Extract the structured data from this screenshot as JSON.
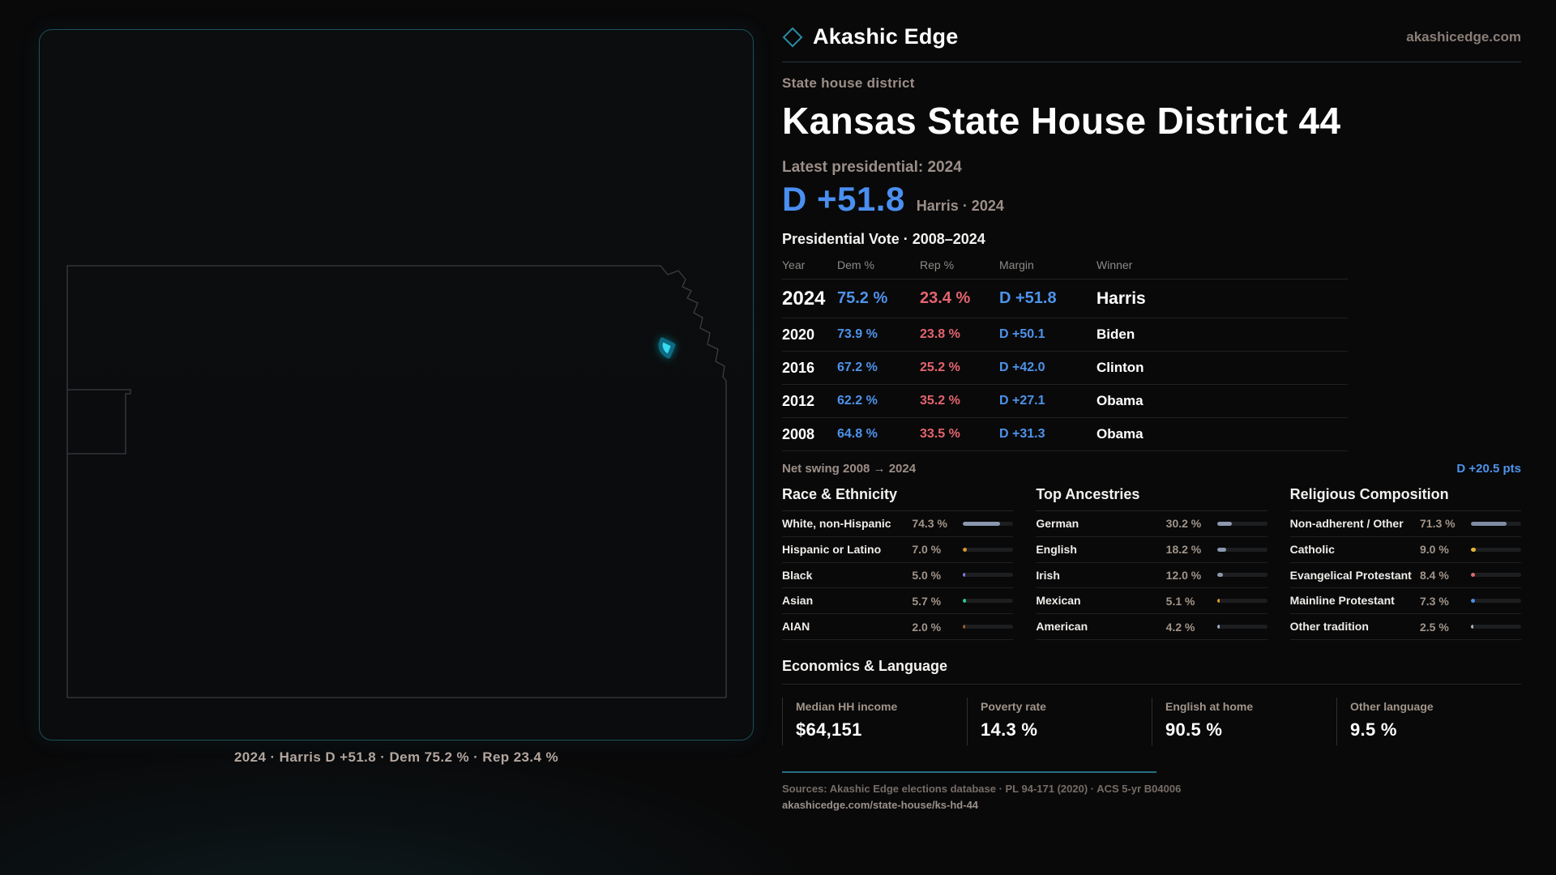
{
  "brand": {
    "name": "Akashic Edge",
    "website": "akashicedge.com"
  },
  "page": {
    "eyebrow": "State house district",
    "title": "Kansas State House District 44",
    "latest_label": "Latest presidential: 2024",
    "latest_margin": "D +51.8",
    "latest_sub": "Harris · 2024"
  },
  "vote_table": {
    "title": "Presidential Vote · 2008–2024",
    "columns": [
      "Year",
      "Dem %",
      "Rep %",
      "Margin",
      "Winner"
    ],
    "rows": [
      {
        "year": "2024",
        "dem": "75.2 %",
        "rep": "23.4 %",
        "margin": "D +51.8",
        "winner": "Harris",
        "featured": true
      },
      {
        "year": "2020",
        "dem": "73.9 %",
        "rep": "23.8 %",
        "margin": "D +50.1",
        "winner": "Biden"
      },
      {
        "year": "2016",
        "dem": "67.2 %",
        "rep": "25.2 %",
        "margin": "D +42.0",
        "winner": "Clinton"
      },
      {
        "year": "2012",
        "dem": "62.2 %",
        "rep": "35.2 %",
        "margin": "D +27.1",
        "winner": "Obama"
      },
      {
        "year": "2008",
        "dem": "64.8 %",
        "rep": "33.5 %",
        "margin": "D +31.3",
        "winner": "Obama"
      }
    ]
  },
  "net_swing": {
    "label": "Net swing 2008 → 2024",
    "value": "D +20.5 pts"
  },
  "demographics": [
    {
      "title": "Race & Ethnicity",
      "rows": [
        {
          "label": "White, non-Hispanic",
          "value": "74.3 %",
          "pct": 74.3,
          "color": "#8b98ae"
        },
        {
          "label": "Hispanic or Latino",
          "value": "7.0 %",
          "pct": 7.0,
          "color": "#d9952f"
        },
        {
          "label": "Black",
          "value": "5.0 %",
          "pct": 5.0,
          "color": "#8577e6"
        },
        {
          "label": "Asian",
          "value": "5.7 %",
          "pct": 5.7,
          "color": "#2fc292"
        },
        {
          "label": "AIAN",
          "value": "2.0 %",
          "pct": 2.0,
          "color": "#9a5c20"
        }
      ]
    },
    {
      "title": "Top Ancestries",
      "rows": [
        {
          "label": "German",
          "value": "30.2 %",
          "pct": 30.2,
          "color": "#8b98ae"
        },
        {
          "label": "English",
          "value": "18.2 %",
          "pct": 18.2,
          "color": "#8b98ae"
        },
        {
          "label": "Irish",
          "value": "12.0 %",
          "pct": 12.0,
          "color": "#8b98ae"
        },
        {
          "label": "Mexican",
          "value": "5.1 %",
          "pct": 5.1,
          "color": "#e09a2d"
        },
        {
          "label": "American",
          "value": "4.2 %",
          "pct": 4.2,
          "color": "#9fb0c8"
        }
      ]
    },
    {
      "title": "Religious Composition",
      "rows": [
        {
          "label": "Non-adherent / Other",
          "value": "71.3 %",
          "pct": 71.3,
          "color": "#7f8da4"
        },
        {
          "label": "Catholic",
          "value": "9.0 %",
          "pct": 9.0,
          "color": "#e3b62e"
        },
        {
          "label": "Evangelical Protestant",
          "value": "8.4 %",
          "pct": 8.4,
          "color": "#e26b6b"
        },
        {
          "label": "Mainline Protestant",
          "value": "7.3 %",
          "pct": 7.3,
          "color": "#4a90e2"
        },
        {
          "label": "Other tradition",
          "value": "2.5 %",
          "pct": 2.5,
          "color": "#aab3bd"
        }
      ]
    }
  ],
  "economics": {
    "title": "Economics & Language",
    "stats": [
      {
        "label": "Median HH income",
        "value": "$64,151"
      },
      {
        "label": "Poverty rate",
        "value": "14.3 %"
      },
      {
        "label": "English at home",
        "value": "90.5 %"
      },
      {
        "label": "Other language",
        "value": "9.5 %"
      }
    ]
  },
  "map": {
    "caption": "2024 · Harris D +51.8 · Dem 75.2 % · Rep 23.4 %",
    "highlight_color": "#38d9f2",
    "outline_color": "#3b3e42",
    "panel_border_color": "#1e4f5a"
  },
  "footer": {
    "sources": "Sources: Akashic Edge elections database · PL 94-171 (2020) · ACS 5-yr B04006",
    "permalink": "akashicedge.com/state-house/ks-hd-44"
  },
  "colors": {
    "dem_blue": "#4e93ea",
    "rep_red": "#e5646e",
    "accent_teal": "#2a8ca3"
  },
  "chart_data": {
    "type": "table",
    "title": "Presidential Vote · 2008–2024",
    "categories": [
      2008,
      2012,
      2016,
      2020,
      2024
    ],
    "series": [
      {
        "name": "Dem %",
        "values": [
          64.8,
          62.2,
          67.2,
          73.9,
          75.2
        ]
      },
      {
        "name": "Rep %",
        "values": [
          33.5,
          35.2,
          25.2,
          23.8,
          23.4
        ]
      },
      {
        "name": "Margin D+",
        "values": [
          31.3,
          27.1,
          42.0,
          50.1,
          51.8
        ]
      }
    ],
    "winners": [
      "Obama",
      "Obama",
      "Clinton",
      "Biden",
      "Harris"
    ],
    "net_swing_pts_D": 20.5
  }
}
